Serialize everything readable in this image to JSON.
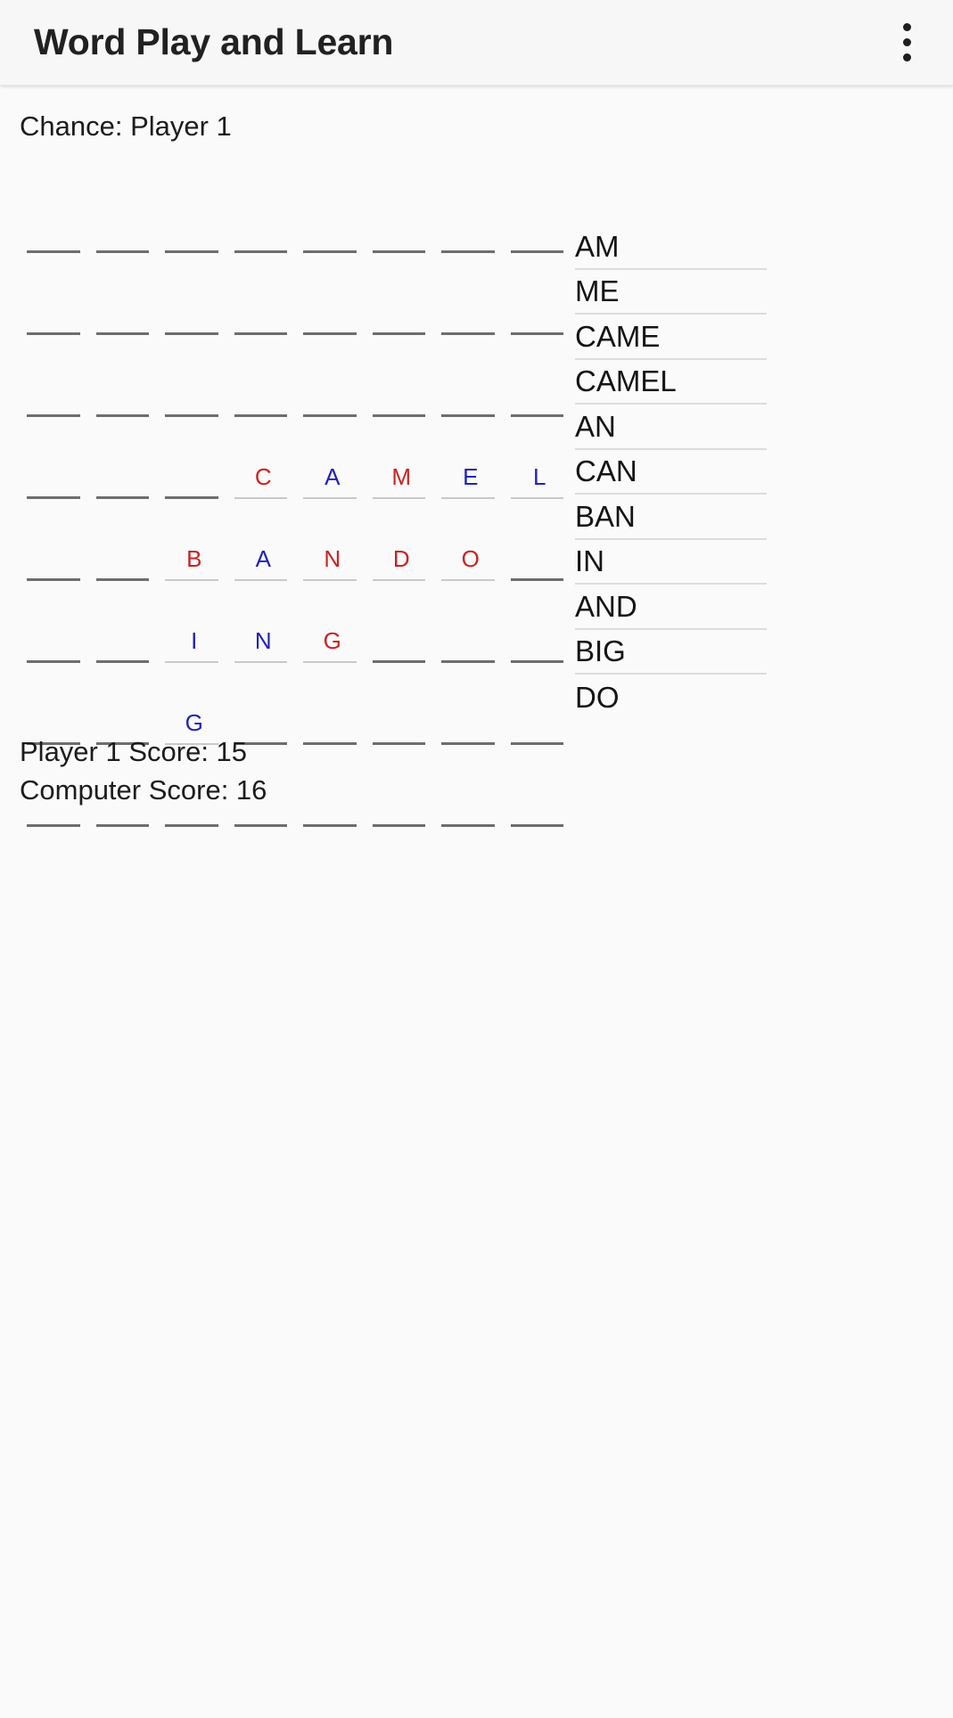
{
  "app": {
    "title": "Word Play and Learn",
    "overflow_menu_icon": "more-vertical-icon"
  },
  "status": {
    "chance": "Chance: Player 1"
  },
  "board": {
    "columns": 8,
    "rows": 8,
    "letter_colors": {
      "red": "#cc2222",
      "blue": "#2222bb"
    },
    "cells": [
      [
        {
          "letter": "",
          "color": ""
        },
        {
          "letter": "",
          "color": ""
        },
        {
          "letter": "",
          "color": ""
        },
        {
          "letter": "",
          "color": ""
        },
        {
          "letter": "",
          "color": ""
        },
        {
          "letter": "",
          "color": ""
        },
        {
          "letter": "",
          "color": ""
        },
        {
          "letter": "",
          "color": ""
        }
      ],
      [
        {
          "letter": "",
          "color": ""
        },
        {
          "letter": "",
          "color": ""
        },
        {
          "letter": "",
          "color": ""
        },
        {
          "letter": "",
          "color": ""
        },
        {
          "letter": "",
          "color": ""
        },
        {
          "letter": "",
          "color": ""
        },
        {
          "letter": "",
          "color": ""
        },
        {
          "letter": "",
          "color": ""
        }
      ],
      [
        {
          "letter": "",
          "color": ""
        },
        {
          "letter": "",
          "color": ""
        },
        {
          "letter": "",
          "color": ""
        },
        {
          "letter": "",
          "color": ""
        },
        {
          "letter": "",
          "color": ""
        },
        {
          "letter": "",
          "color": ""
        },
        {
          "letter": "",
          "color": ""
        },
        {
          "letter": "",
          "color": ""
        }
      ],
      [
        {
          "letter": "",
          "color": ""
        },
        {
          "letter": "",
          "color": ""
        },
        {
          "letter": "",
          "color": ""
        },
        {
          "letter": "C",
          "color": "red"
        },
        {
          "letter": "A",
          "color": "blue"
        },
        {
          "letter": "M",
          "color": "red"
        },
        {
          "letter": "E",
          "color": "blue"
        },
        {
          "letter": "L",
          "color": "blue"
        }
      ],
      [
        {
          "letter": "",
          "color": ""
        },
        {
          "letter": "",
          "color": ""
        },
        {
          "letter": "B",
          "color": "red"
        },
        {
          "letter": "A",
          "color": "blue"
        },
        {
          "letter": "N",
          "color": "red"
        },
        {
          "letter": "D",
          "color": "red"
        },
        {
          "letter": "O",
          "color": "red"
        },
        {
          "letter": "",
          "color": ""
        }
      ],
      [
        {
          "letter": "",
          "color": ""
        },
        {
          "letter": "",
          "color": ""
        },
        {
          "letter": "I",
          "color": "blue"
        },
        {
          "letter": "N",
          "color": "blue"
        },
        {
          "letter": "G",
          "color": "red"
        },
        {
          "letter": "",
          "color": ""
        },
        {
          "letter": "",
          "color": ""
        },
        {
          "letter": "",
          "color": ""
        }
      ],
      [
        {
          "letter": "",
          "color": ""
        },
        {
          "letter": "",
          "color": ""
        },
        {
          "letter": "G",
          "color": "blue"
        },
        {
          "letter": "",
          "color": ""
        },
        {
          "letter": "",
          "color": ""
        },
        {
          "letter": "",
          "color": ""
        },
        {
          "letter": "",
          "color": ""
        },
        {
          "letter": "",
          "color": ""
        }
      ],
      [
        {
          "letter": "",
          "color": ""
        },
        {
          "letter": "",
          "color": ""
        },
        {
          "letter": "",
          "color": ""
        },
        {
          "letter": "",
          "color": ""
        },
        {
          "letter": "",
          "color": ""
        },
        {
          "letter": "",
          "color": ""
        },
        {
          "letter": "",
          "color": ""
        },
        {
          "letter": "",
          "color": ""
        }
      ]
    ]
  },
  "wordlist": {
    "words": [
      "AM",
      "ME",
      "CAME",
      "CAMEL",
      "AN",
      "CAN",
      "BAN",
      "IN",
      "AND",
      "BIG",
      "DO"
    ]
  },
  "scores": {
    "player1": "Player 1 Score: 15",
    "computer": "Computer Score: 16"
  }
}
